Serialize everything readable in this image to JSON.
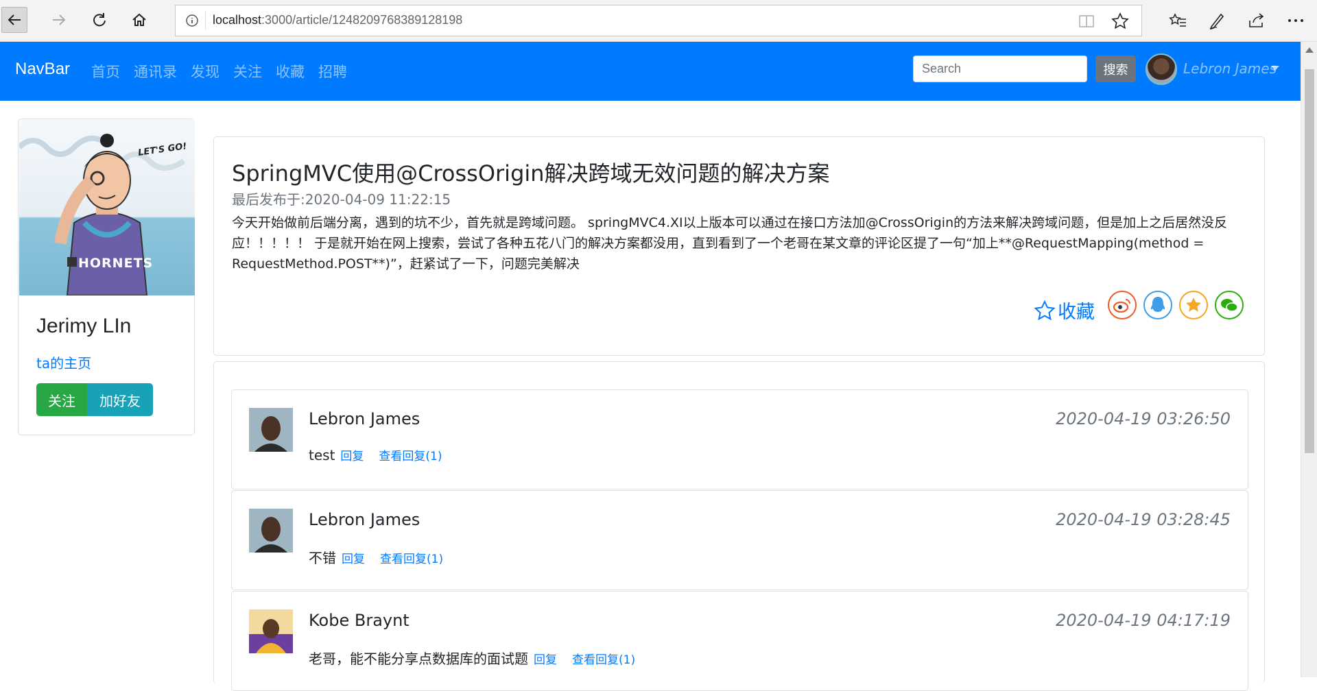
{
  "browser": {
    "url_host": "localhost",
    "url_rest": ":3000/article/1248209768389128198"
  },
  "navbar": {
    "brand": "NavBar",
    "links": [
      "首页",
      "通讯录",
      "发现",
      "关注",
      "收藏",
      "招聘"
    ],
    "search_placeholder": "Search",
    "search_button": "搜索",
    "user_name": "Lebron James"
  },
  "profile": {
    "image_caption": "LET'S GO!",
    "jersey_text": "HORNETS",
    "name": "Jerimy LIn",
    "home_link": "ta的主页",
    "follow_button": "关注",
    "friend_button": "加好友"
  },
  "article": {
    "title": "SpringMVC使用@CrossOrigin解决跨域无效问题的解决方案",
    "date": "最后发布于:2020-04-09 11:22:15",
    "body": "今天开始做前后端分离，遇到的坑不少，首先就是跨域问题。 springMVC4.XI以上版本可以通过在接口方法加@CrossOrigin的方法来解决跨域问题，但是加上之后居然没反应！！！！！ 于是就开始在网上搜索，尝试了各种五花八门的解决方案都没用，直到看到了一个老哥在某文章的评论区提了一句“加上**@RequestMapping(method = RequestMethod.POST**)”，赶紧试了一下，问题完美解决",
    "collect_label": "收藏",
    "share_icons": [
      "weibo-icon",
      "qq-icon",
      "qzone-icon",
      "wechat-icon"
    ],
    "share_colors": [
      "#f05a24",
      "#3c9ee8",
      "#f5a623",
      "#2aae0e"
    ]
  },
  "comments": [
    {
      "name": "Lebron James",
      "time": "2020-04-19 03:26:50",
      "text": "test",
      "reply": "回复",
      "view_replies": "查看回复(1)"
    },
    {
      "name": "Lebron James",
      "time": "2020-04-19 03:28:45",
      "text": "不错",
      "reply": "回复",
      "view_replies": "查看回复(1)"
    },
    {
      "name": "Kobe Braynt",
      "time": "2020-04-19 04:17:19",
      "text": "老哥，能不能分享点数据库的面试题",
      "reply": "回复",
      "view_replies": "查看回复(1)"
    }
  ]
}
